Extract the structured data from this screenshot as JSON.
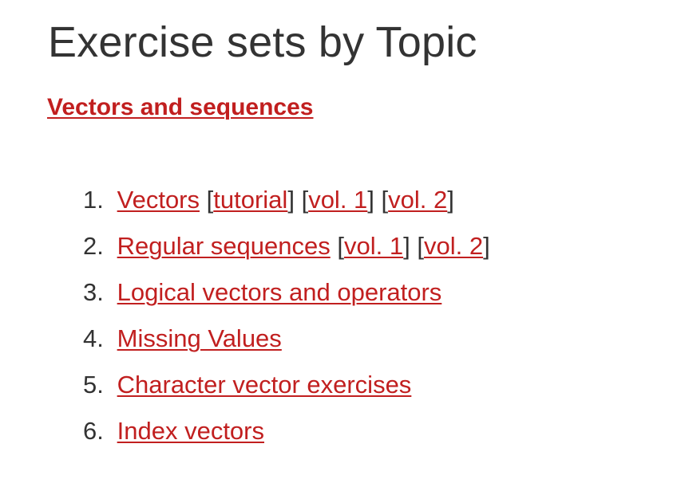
{
  "page": {
    "title": "Exercise sets by Topic"
  },
  "section": {
    "heading": "Vectors and sequences"
  },
  "topics": [
    {
      "number": "1.",
      "label": "Vectors",
      "extras": [
        "tutorial",
        "vol. 1",
        "vol. 2"
      ]
    },
    {
      "number": "2.",
      "label": "Regular sequences",
      "extras": [
        "vol. 1",
        "vol. 2"
      ]
    },
    {
      "number": "3.",
      "label": "Logical vectors and operators",
      "extras": []
    },
    {
      "number": "4.",
      "label": "Missing Values",
      "extras": []
    },
    {
      "number": "5.",
      "label": "Character vector exercises",
      "extras": []
    },
    {
      "number": "6.",
      "label": "Index vectors",
      "extras": []
    }
  ],
  "colors": {
    "link": "#c11f1f",
    "text": "#333333",
    "background": "#ffffff"
  }
}
